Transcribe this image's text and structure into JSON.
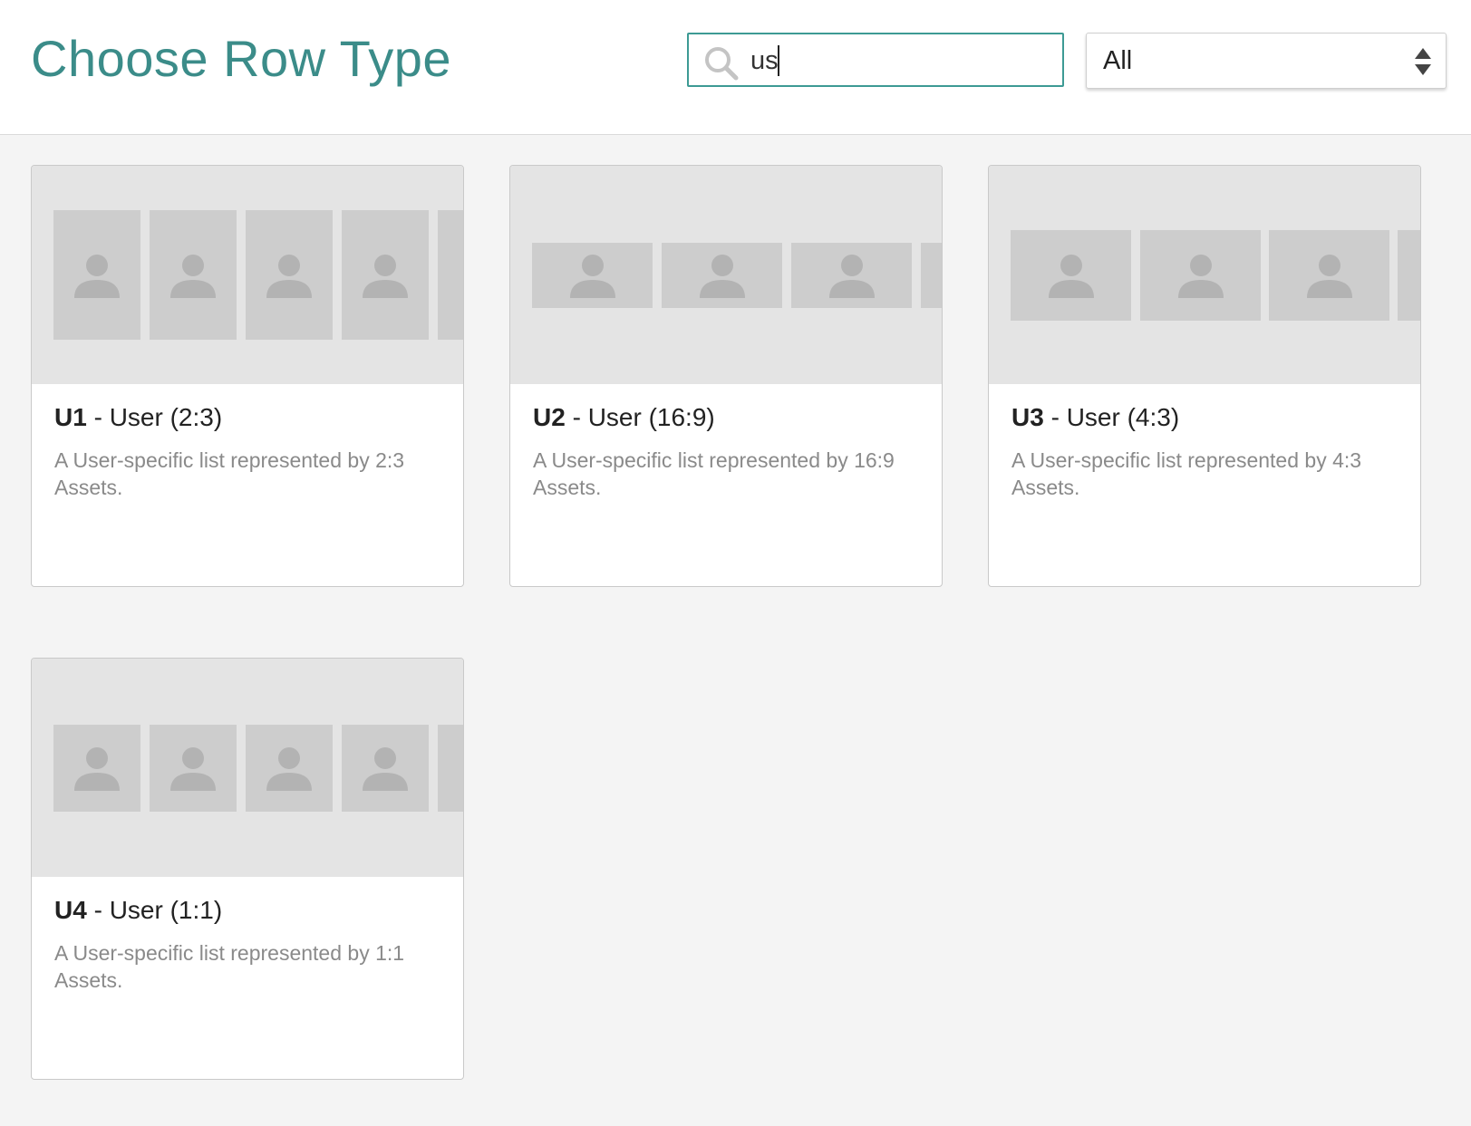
{
  "header": {
    "title": "Choose Row Type",
    "search": {
      "value": "us",
      "placeholder": ""
    },
    "filter": {
      "selected": "All"
    }
  },
  "cards": [
    {
      "code": "U1",
      "separator": " - ",
      "name": "User (2:3)",
      "description": "A User-specific list represented by 2:3 Assets.",
      "aspect_ratio": "2:3"
    },
    {
      "code": "U2",
      "separator": " - ",
      "name": "User (16:9)",
      "description": "A User-specific list represented by 16:9 Assets.",
      "aspect_ratio": "16:9"
    },
    {
      "code": "U3",
      "separator": " - ",
      "name": "User (4:3)",
      "description": "A User-specific list represented by 4:3 Assets.",
      "aspect_ratio": "4:3"
    },
    {
      "code": "U4",
      "separator": " - ",
      "name": "User (1:1)",
      "description": "A User-specific list represented by 1:1 Assets.",
      "aspect_ratio": "1:1"
    }
  ],
  "icons": {
    "search": "search-icon",
    "select": "sort-arrows-icon",
    "tile": "user-avatar-icon"
  },
  "colors": {
    "accent": "#3b8c89",
    "preview_bg": "#e4e4e4",
    "tile_bg": "#cdcdcd",
    "avatar": "#b3b3b3"
  }
}
